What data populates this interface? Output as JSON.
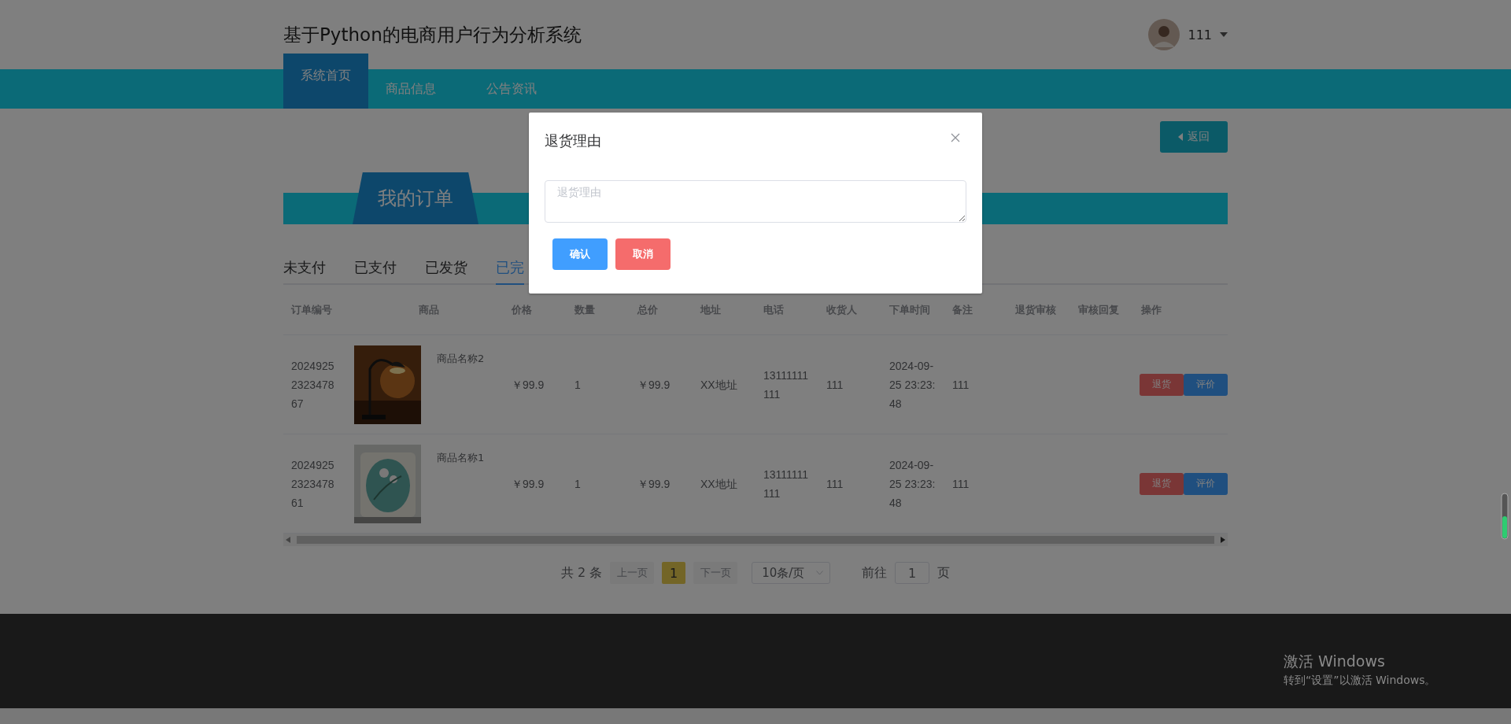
{
  "header": {
    "title": "基于Python的电商用户行为分析系统",
    "user": "111"
  },
  "nav": [
    {
      "label": "系统首页",
      "selected": true
    },
    {
      "label": "商品信息",
      "selected": false
    },
    {
      "label": "公告资讯",
      "selected": false
    }
  ],
  "back_button": "返回",
  "section_title": "我的订单",
  "tabs": [
    {
      "label": "未支付",
      "selected": false
    },
    {
      "label": "已支付",
      "selected": false
    },
    {
      "label": "已发货",
      "selected": false
    },
    {
      "label": "已完",
      "selected": true
    }
  ],
  "table": {
    "columns": [
      "订单编号",
      "商品",
      "价格",
      "数量",
      "总价",
      "地址",
      "电话",
      "收货人",
      "下单时间",
      "备注",
      "退货审核",
      "审核回复",
      "操作"
    ],
    "rows": [
      {
        "order_no": "2024925232347867",
        "product": {
          "kind": "picture",
          "name": "商品名称2"
        },
        "price": "￥99.9",
        "quantity": "1",
        "total": "￥99.9",
        "address": "XX地址",
        "phone": "13111111111",
        "receiver": "111",
        "time": "2024-09-25 23:23:48",
        "note": "111",
        "actions": [
          {
            "label": "退货",
            "kind": "danger"
          },
          {
            "label": "评价",
            "kind": "primary"
          }
        ]
      },
      {
        "order_no": "2024925232347861",
        "product": {
          "kind": "picture",
          "name": "商品名称1"
        },
        "price": "￥99.9",
        "quantity": "1",
        "total": "￥99.9",
        "address": "XX地址",
        "phone": "13111111111",
        "receiver": "111",
        "time": "2024-09-25 23:23:48",
        "note": "111",
        "actions": [
          {
            "label": "退货",
            "kind": "danger"
          },
          {
            "label": "评价",
            "kind": "primary"
          }
        ]
      }
    ]
  },
  "pagination": {
    "total": "共 2 条",
    "prev": {
      "label": "上一页",
      "disabled": true
    },
    "pages": [
      {
        "label": "1",
        "selected": true
      }
    ],
    "next": {
      "label": "下一页",
      "disabled": true
    },
    "page_size": "10条/页",
    "goto_label": "前往",
    "goto_value": "1",
    "goto_suffix": "页"
  },
  "dialog": {
    "title": "退货理由",
    "placeholder": "退货理由",
    "buttons": [
      {
        "label": "确认",
        "kind": "primary"
      },
      {
        "label": "取消",
        "kind": "danger"
      }
    ]
  },
  "os_notice": {
    "title": "激活 Windows",
    "subtitle": "转到“设置”以激活 Windows。"
  }
}
